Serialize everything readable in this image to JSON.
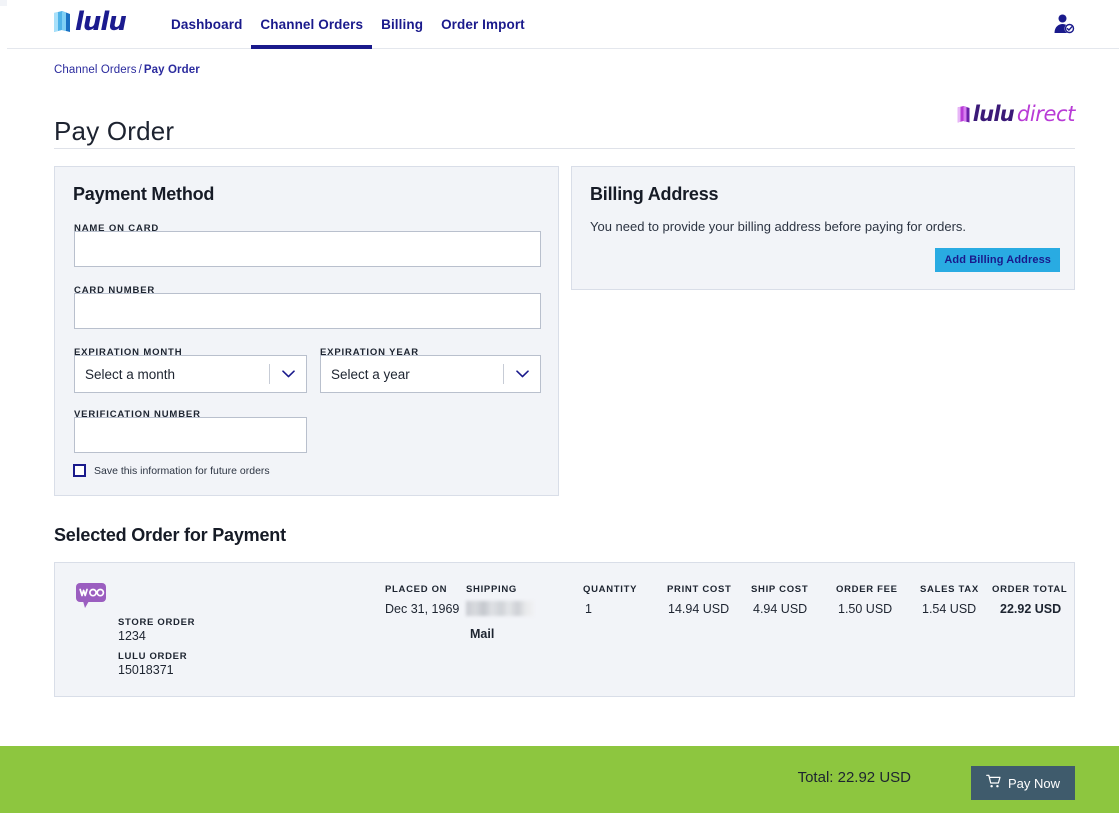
{
  "nav": {
    "brand": {
      "word": "lulu",
      "icon": "lulu-book-icon"
    },
    "links": [
      {
        "label": "Dashboard",
        "active": false
      },
      {
        "label": "Channel Orders",
        "active": true
      },
      {
        "label": "Billing",
        "active": false
      },
      {
        "label": "Order Import",
        "active": false
      }
    ],
    "account_icon": "account-user-icon"
  },
  "breadcrumb": {
    "parent": "Channel Orders",
    "separator": "/",
    "current": "Pay Order"
  },
  "header": {
    "title": "Pay Order",
    "logo": {
      "part1": "lulu",
      "part2": "direct"
    }
  },
  "payment": {
    "heading": "Payment Method",
    "name_on_card": {
      "label": "NAME ON CARD",
      "value": "",
      "placeholder": ""
    },
    "card_number": {
      "label": "CARD NUMBER",
      "value": "",
      "placeholder": ""
    },
    "expiration_month": {
      "label": "EXPIRATION MONTH",
      "selected": "Select a month"
    },
    "expiration_year": {
      "label": "EXPIRATION YEAR",
      "selected": "Select a year"
    },
    "verification_number": {
      "label": "VERIFICATION NUMBER",
      "value": "",
      "placeholder": ""
    },
    "save_checkbox": {
      "label": "Save this information for future orders",
      "checked": false
    }
  },
  "billing": {
    "heading": "Billing Address",
    "message": "You need to provide your billing address before paying for orders.",
    "add_button": "Add Billing Address",
    "accent_color": "#29abe2"
  },
  "selected_order": {
    "heading": "Selected Order for Payment",
    "channel_icon": "woocommerce-icon",
    "store_order": {
      "label": "STORE ORDER",
      "value": "1234"
    },
    "lulu_order": {
      "label": "LULU ORDER",
      "value": "15018371"
    },
    "columns": [
      {
        "header": "PLACED ON",
        "value": "Dec 31, 1969"
      },
      {
        "header": "SHIPPING",
        "value": "Mail"
      },
      {
        "header": "QUANTITY",
        "value": "1"
      },
      {
        "header": "PRINT COST",
        "value": "14.94 USD"
      },
      {
        "header": "SHIP COST",
        "value": "4.94 USD"
      },
      {
        "header": "ORDER FEE",
        "value": "1.50 USD"
      },
      {
        "header": "SALES TAX",
        "value": "1.54 USD"
      },
      {
        "header": "ORDER TOTAL",
        "value": "22.92 USD"
      }
    ]
  },
  "footer": {
    "total": "Total: 22.92 USD",
    "pay_button": "Pay Now",
    "cart_icon": "shopping-cart-icon",
    "bar_color": "#8dc63f"
  }
}
